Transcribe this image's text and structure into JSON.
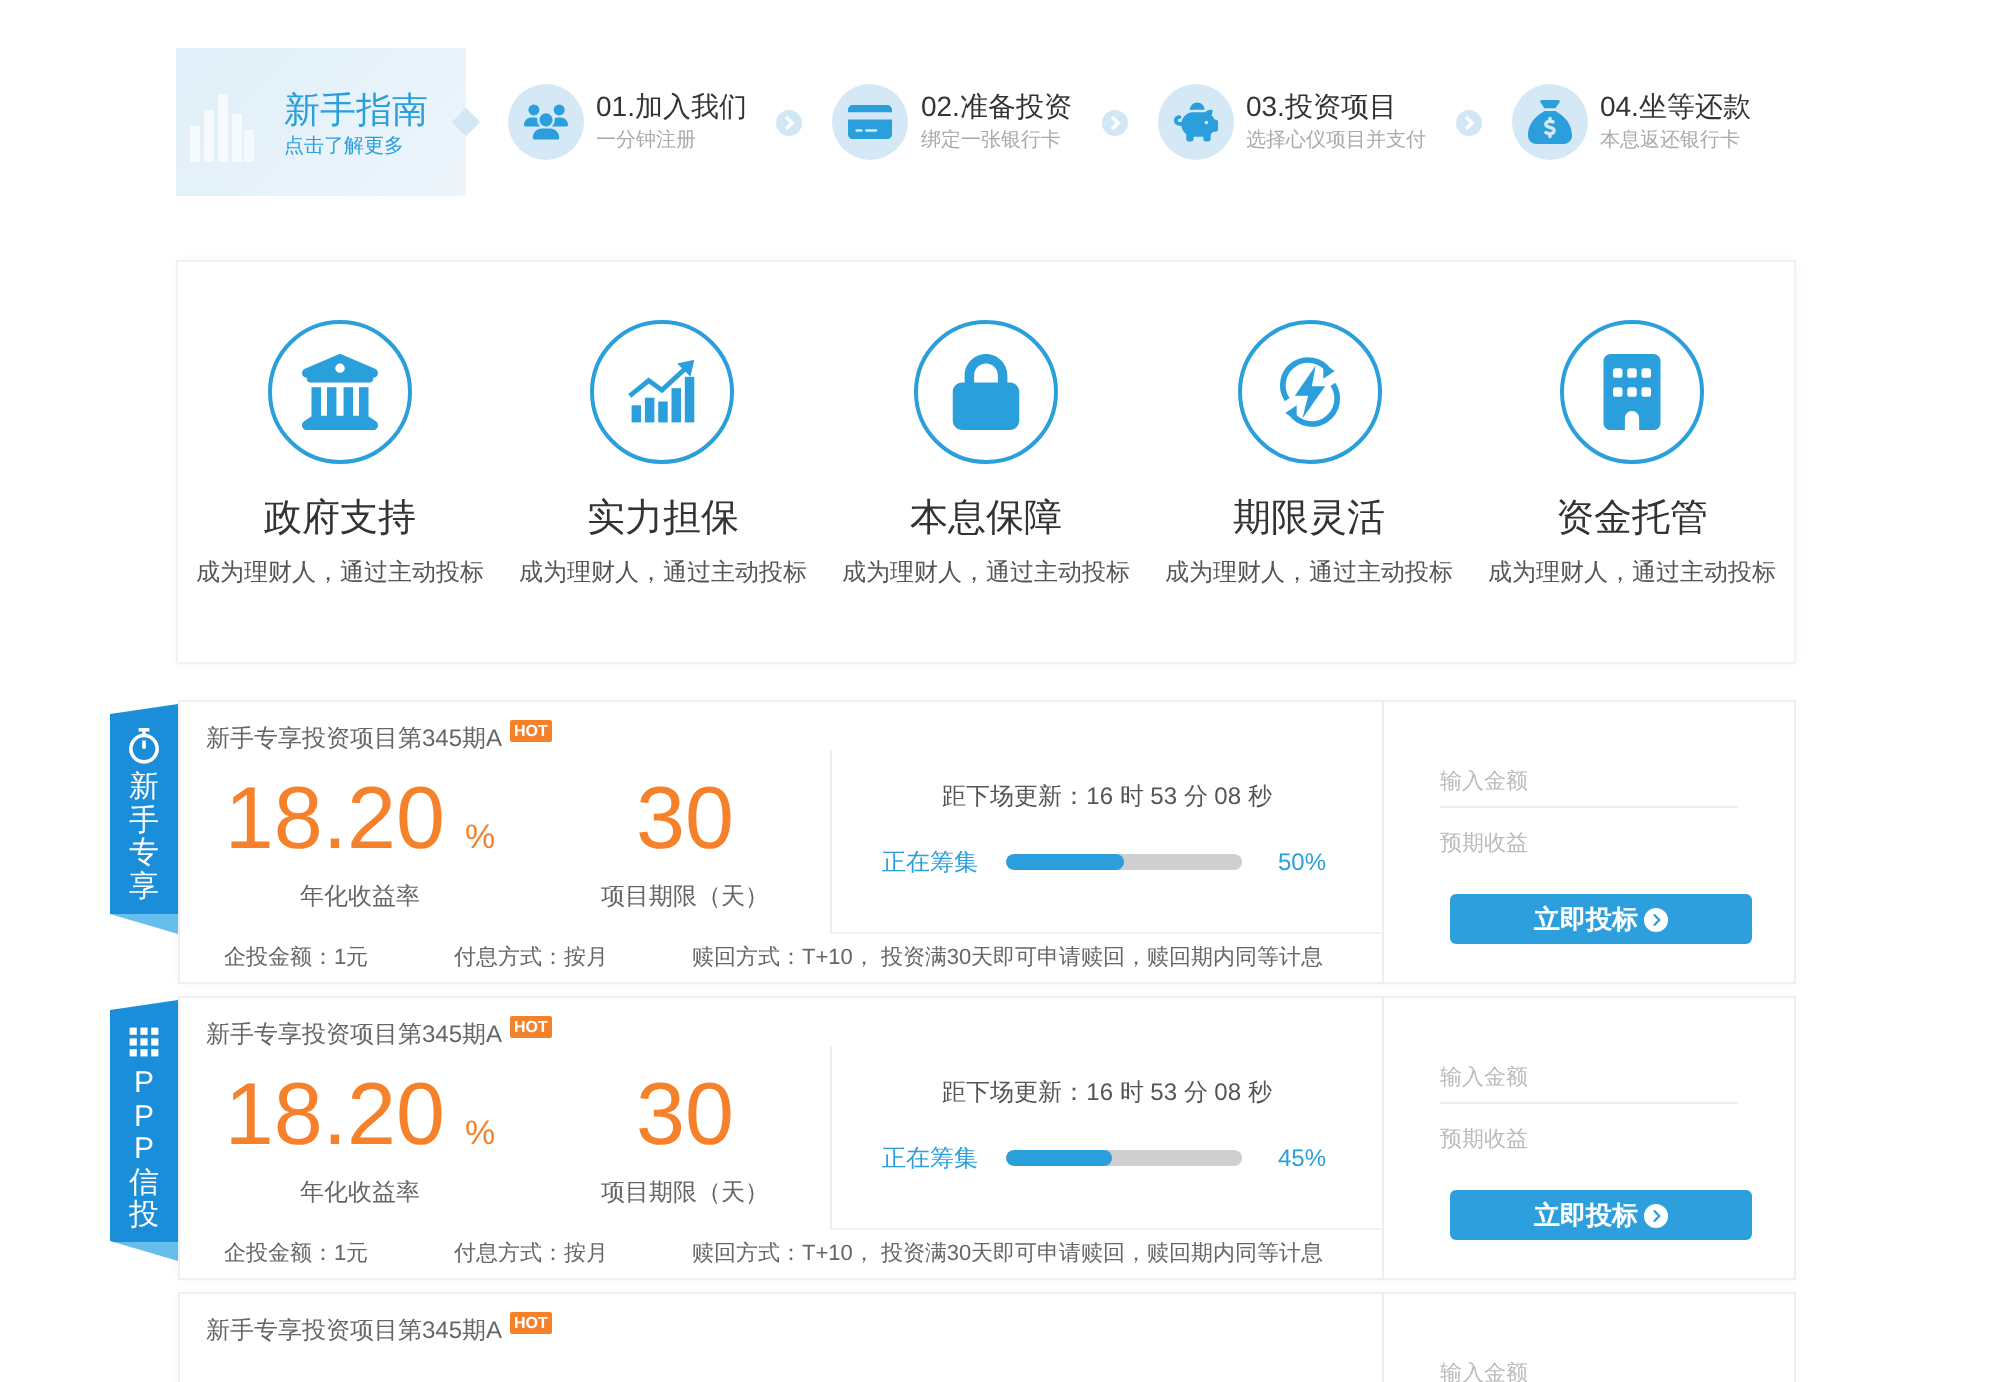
{
  "guide": {
    "title": "新手指南",
    "link": "点击了解更多"
  },
  "steps": [
    {
      "title": "01.加入我们",
      "subtitle": "一分钟注册"
    },
    {
      "title": "02.准备投资",
      "subtitle": "绑定一张银行卡"
    },
    {
      "title": "03.投资项目",
      "subtitle": "选择心仪项目并支付"
    },
    {
      "title": "04.坐等还款",
      "subtitle": "本息返还银行卡"
    }
  ],
  "features": [
    {
      "title": "政府支持",
      "subtitle": "成为理财人，通过主动投标"
    },
    {
      "title": "实力担保",
      "subtitle": "成为理财人，通过主动投标"
    },
    {
      "title": "本息保障",
      "subtitle": "成为理财人，通过主动投标"
    },
    {
      "title": "期限灵活",
      "subtitle": "成为理财人，通过主动投标"
    },
    {
      "title": "资金托管",
      "subtitle": "成为理财人，通过主动投标"
    }
  ],
  "products": [
    {
      "tag": {
        "label": "新手专享",
        "kind": "newbie"
      },
      "title": "新手专享投资项目第345期A",
      "badge": "HOT",
      "rate": "18.20",
      "rate_unit": "%",
      "rate_label": "年化收益率",
      "term": "30",
      "term_label": "项目期限（天）",
      "countdown": "距下场更新：16 时 53 分 08 秒",
      "status": "正在筹集",
      "level": 0.5,
      "percent": "50%",
      "min_amount": "企投金额：1元",
      "interest": "付息方式：按月",
      "redeem": "赎回方式：T+10， 投资满30天即可申请赎回，赎回期内同等计息",
      "amount_placeholder": "输入金额",
      "return_placeholder": "预期收益",
      "button": "立即投标"
    },
    {
      "tag": {
        "label": "PPP信投",
        "kind": "ppp"
      },
      "title": "新手专享投资项目第345期A",
      "badge": "HOT",
      "rate": "18.20",
      "rate_unit": "%",
      "rate_label": "年化收益率",
      "term": "30",
      "term_label": "项目期限（天）",
      "countdown": "距下场更新：16 时 53 分 08 秒",
      "status": "正在筹集",
      "level": 0.45,
      "percent": "45%",
      "min_amount": "企投金额：1元",
      "interest": "付息方式：按月",
      "redeem": "赎回方式：T+10， 投资满30天即可申请赎回，赎回期内同等计息",
      "amount_placeholder": "输入金额",
      "return_placeholder": "预期收益",
      "button": "立即投标"
    },
    {
      "title": "新手专享投资项目第345期A",
      "badge": "HOT",
      "amount_placeholder": "输入金额"
    }
  ]
}
